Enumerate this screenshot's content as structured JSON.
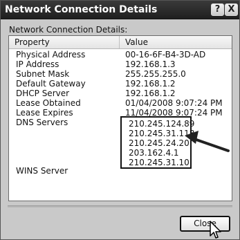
{
  "window": {
    "title": "Network Connection Details",
    "buttons": {
      "help_label": "?",
      "close_label": "X"
    }
  },
  "content": {
    "section_label": "Network Connection Details:",
    "columns": {
      "property": "Property",
      "value": "Value"
    },
    "rows": [
      {
        "property": "Physical Address",
        "value": "00-16-6F-B4-3D-AD"
      },
      {
        "property": "IP Address",
        "value": "192.168.1.3"
      },
      {
        "property": "Subnet Mask",
        "value": "255.255.255.0"
      },
      {
        "property": "Default Gateway",
        "value": "192.168.1.2"
      },
      {
        "property": "DHCP Server",
        "value": "192.168.1.2"
      },
      {
        "property": "Lease Obtained",
        "value": "01/04/2008 9:07:24 PM"
      },
      {
        "property": "Lease Expires",
        "value": "11/04/2008 9:07:24 PM"
      },
      {
        "property": "DNS Servers",
        "value": ""
      },
      {
        "property": "",
        "value": ""
      },
      {
        "property": "",
        "value": ""
      },
      {
        "property": "",
        "value": ""
      },
      {
        "property": "",
        "value": ""
      },
      {
        "property": "WINS Server",
        "value": ""
      }
    ],
    "dns_servers": [
      "210.245.124.89",
      "210.245.31.118",
      "210.245.24.20",
      "203.162.4.1",
      "210.245.31.10"
    ]
  },
  "footer": {
    "close_button_label": "Close"
  },
  "colors": {
    "titlebar": "#2a2a2a",
    "window": "#c9c9c9",
    "list_bg": "#ffffff"
  }
}
